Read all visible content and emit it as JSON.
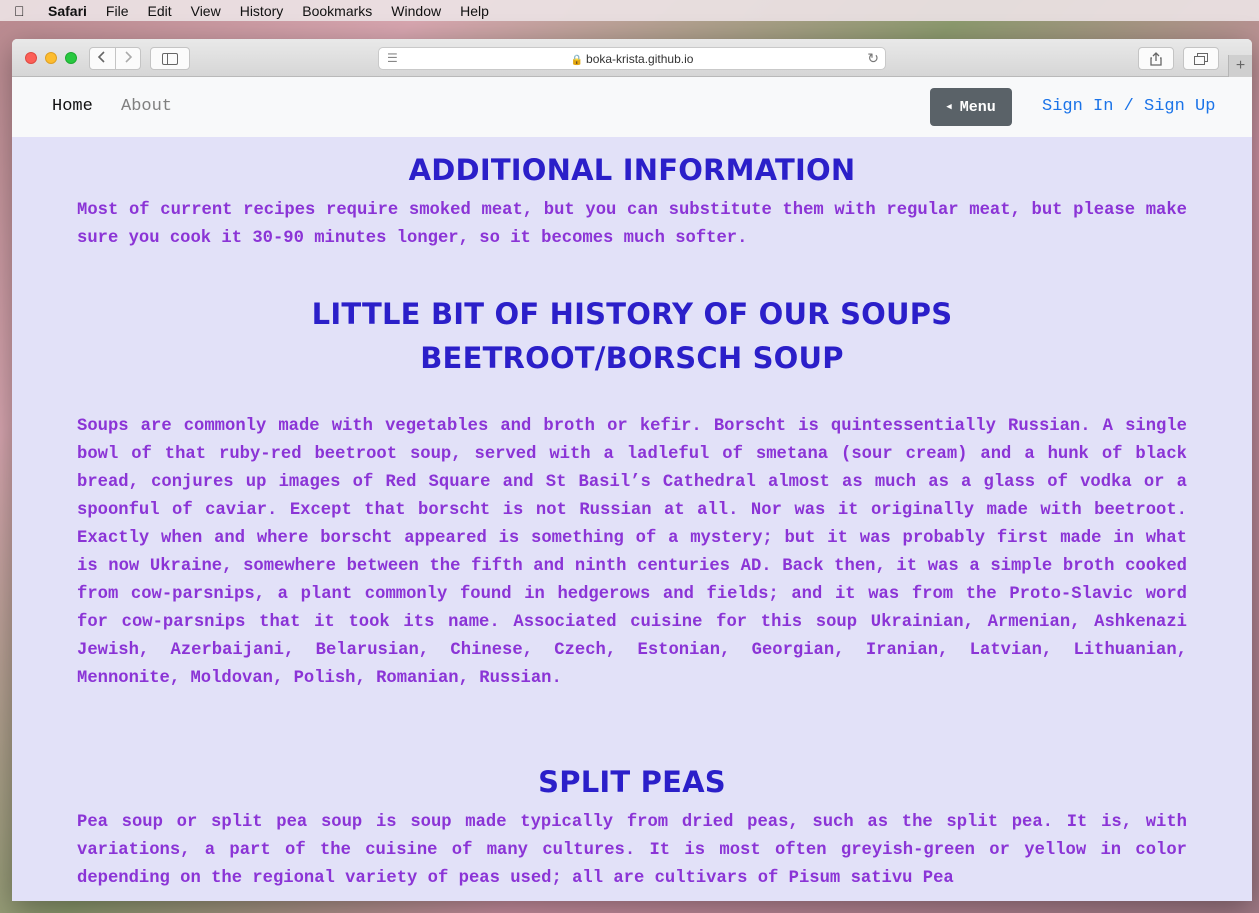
{
  "os_menubar": {
    "apple": "",
    "app": "Safari",
    "items": [
      "File",
      "Edit",
      "View",
      "History",
      "Bookmarks",
      "Window",
      "Help"
    ]
  },
  "browser": {
    "url": "boka-krista.github.io",
    "back_icon": "chevron-left",
    "forward_icon": "chevron-right",
    "newtab": "+"
  },
  "navbar": {
    "home": "Home",
    "about": "About",
    "menu": "Menu",
    "signin": "Sign In / Sign Up"
  },
  "content": {
    "h1": "ADDITIONAL INFORMATION",
    "p1": "Most of current recipes require smoked meat, but you can substitute them with regular meat, but please make sure you cook it 30-90 minutes longer, so it becomes much softer.",
    "h2": "LITTLE BIT OF HISTORY OF OUR SOUPS",
    "h3": "BEETROOT/BORSCH SOUP",
    "p2": "Soups are commonly made with vegetables and broth or kefir. Borscht is quintessentially Russian. A single bowl of that ruby-red beetroot soup, served with a ladleful of smetana (sour cream) and a hunk of black bread, conjures up images of Red Square and St Basil’s Cathedral almost as much as a glass of vodka or a spoonful of caviar. Except that borscht is not Russian at all. Nor was it originally made with beetroot. Exactly when and where borscht appeared is something of a mystery; but it was probably first made in what is now Ukraine, somewhere between the fifth and ninth centuries AD. Back then, it was a simple broth cooked from cow-parsnips, a plant commonly found in hedgerows and fields; and it was from the Proto-Slavic word for cow-parsnips that it took its name. Associated cuisine for this soup Ukrainian, Armenian, Ashkenazi Jewish, Azerbaijani, Belarusian, Chinese, Czech, Estonian, Georgian, Iranian, Latvian, Lithuanian, Mennonite, Moldovan, Polish, Romanian, Russian.",
    "h4": "SPLIT PEAS",
    "p3": "Pea soup or split pea soup is soup made typically from dried peas, such as the split pea. It is, with variations, a part of the cuisine of many cultures. It is most often greyish-green or yellow in color depending on the regional variety of peas used; all are cultivars of Pisum sativu Pea"
  }
}
